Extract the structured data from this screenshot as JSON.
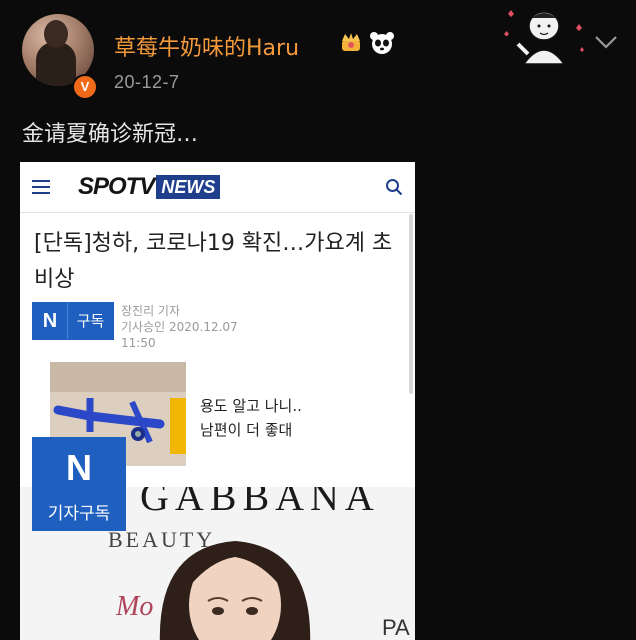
{
  "post": {
    "username": "草莓牛奶味的Haru",
    "verified_badge": "V",
    "date": "20-12-7",
    "caption": "金请夏确诊新冠…",
    "icons": [
      "crown-icon",
      "panda-icon",
      "chevron-down-icon"
    ]
  },
  "article": {
    "logo_spotv": "SPOTV",
    "logo_news": "NEWS",
    "headline": "[단독]청하, 코로나19 확진…가요계 초비상",
    "subscribe_n": "N",
    "subscribe_label": "구독",
    "reporter": "장진리 기자",
    "published": "기사승인 2020.12.07",
    "time": "11:50",
    "ad_line1": "용도 알고 나니..",
    "ad_line2": "남편이 더 좋대",
    "photo_brand": "GABBANA",
    "photo_beauty": "BEAUTY",
    "photo_pa": "PA",
    "photo_script": "Mo",
    "float_n": "N",
    "float_label": "기자구독"
  },
  "colors": {
    "background": "#0b0b0c",
    "username": "#f59a3b",
    "date": "#9a9a9a",
    "badge": "#f06a1a",
    "news_blue": "#1f3f8c",
    "subscribe_blue": "#1f5fbf"
  }
}
